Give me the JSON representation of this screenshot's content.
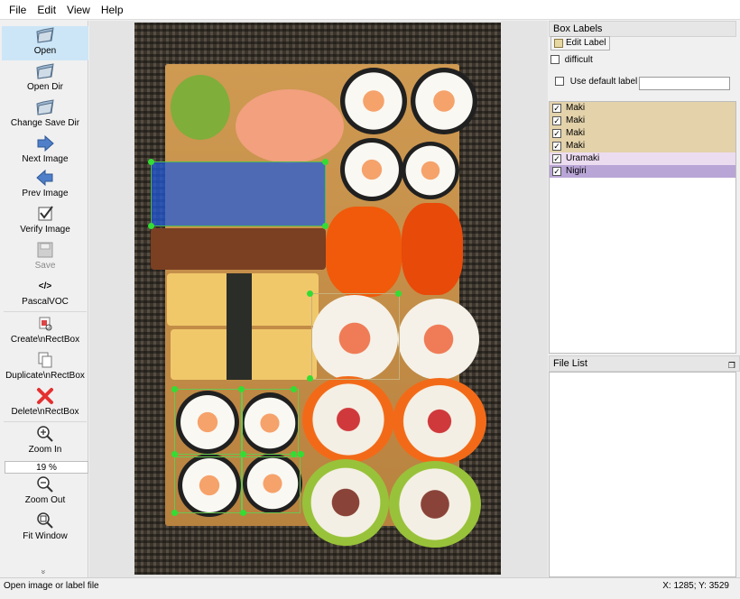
{
  "menu": [
    "File",
    "Edit",
    "View",
    "Help"
  ],
  "toolbar": {
    "open": "Open",
    "open_dir": "Open Dir",
    "change_save_dir": "Change Save Dir",
    "next_image": "Next Image",
    "prev_image": "Prev Image",
    "verify_image": "Verify Image",
    "save": "Save",
    "format": "PascalVOC",
    "create_rect": "Create\\nRectBox",
    "duplicate_rect": "Duplicate\\nRectBox",
    "delete_rect": "Delete\\nRectBox",
    "zoom_in": "Zoom In",
    "zoom_value": "19 %",
    "zoom_out": "Zoom Out",
    "fit_window": "Fit Window",
    "format_icon_glyph": "</>",
    "more_glyph": "»"
  },
  "box_labels": {
    "title": "Box Labels",
    "edit_label": "Edit Label",
    "difficult": "difficult",
    "use_default_label": "Use default label",
    "default_label_value": "",
    "items": [
      {
        "label": "Maki",
        "checked": true,
        "color": "#e3d2aa"
      },
      {
        "label": "Maki",
        "checked": true,
        "color": "#e3d2aa"
      },
      {
        "label": "Maki",
        "checked": true,
        "color": "#e3d2aa"
      },
      {
        "label": "Maki",
        "checked": true,
        "color": "#e3d2aa"
      },
      {
        "label": "Uramaki",
        "checked": true,
        "color": "#ecdcf0"
      },
      {
        "label": "Nigiri",
        "checked": true,
        "color": "#b9a5d6"
      }
    ]
  },
  "file_list": {
    "title": "File List"
  },
  "status": {
    "message": "Open image or label file",
    "coords": "X: 1285; Y: 3529"
  }
}
